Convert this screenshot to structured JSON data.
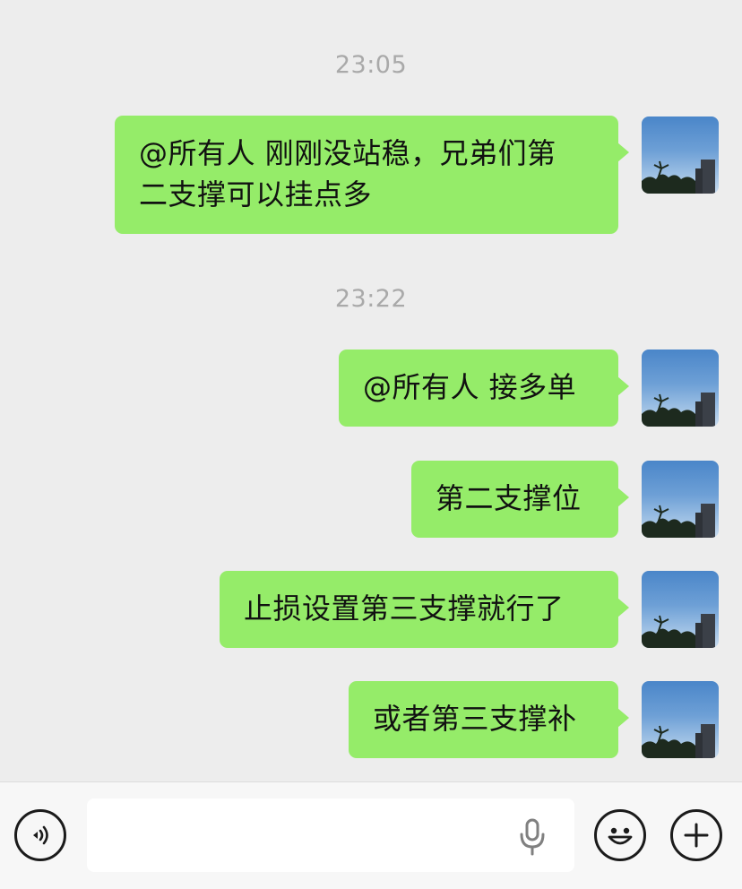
{
  "colors": {
    "background": "#ededed",
    "bubble_self": "#95ec69",
    "timestamp": "#a9a9a9",
    "bottom_bar": "#f7f7f7"
  },
  "messages": {
    "time_1": "23:05",
    "msg_1": "@所有人 刚刚没站稳，兄弟们第\n二支撑可以挂点多",
    "time_2": "23:22",
    "msg_2": "@所有人 接多单",
    "msg_3": "第二支撑位",
    "msg_4": "止损设置第三支撑就行了",
    "msg_5": "或者第三支撑补"
  },
  "input_bar": {
    "left_icon": "voice-icon",
    "mic_icon": "microphone-icon",
    "emoji_icon": "emoji-icon",
    "plus_icon": "plus-icon",
    "text": ""
  }
}
